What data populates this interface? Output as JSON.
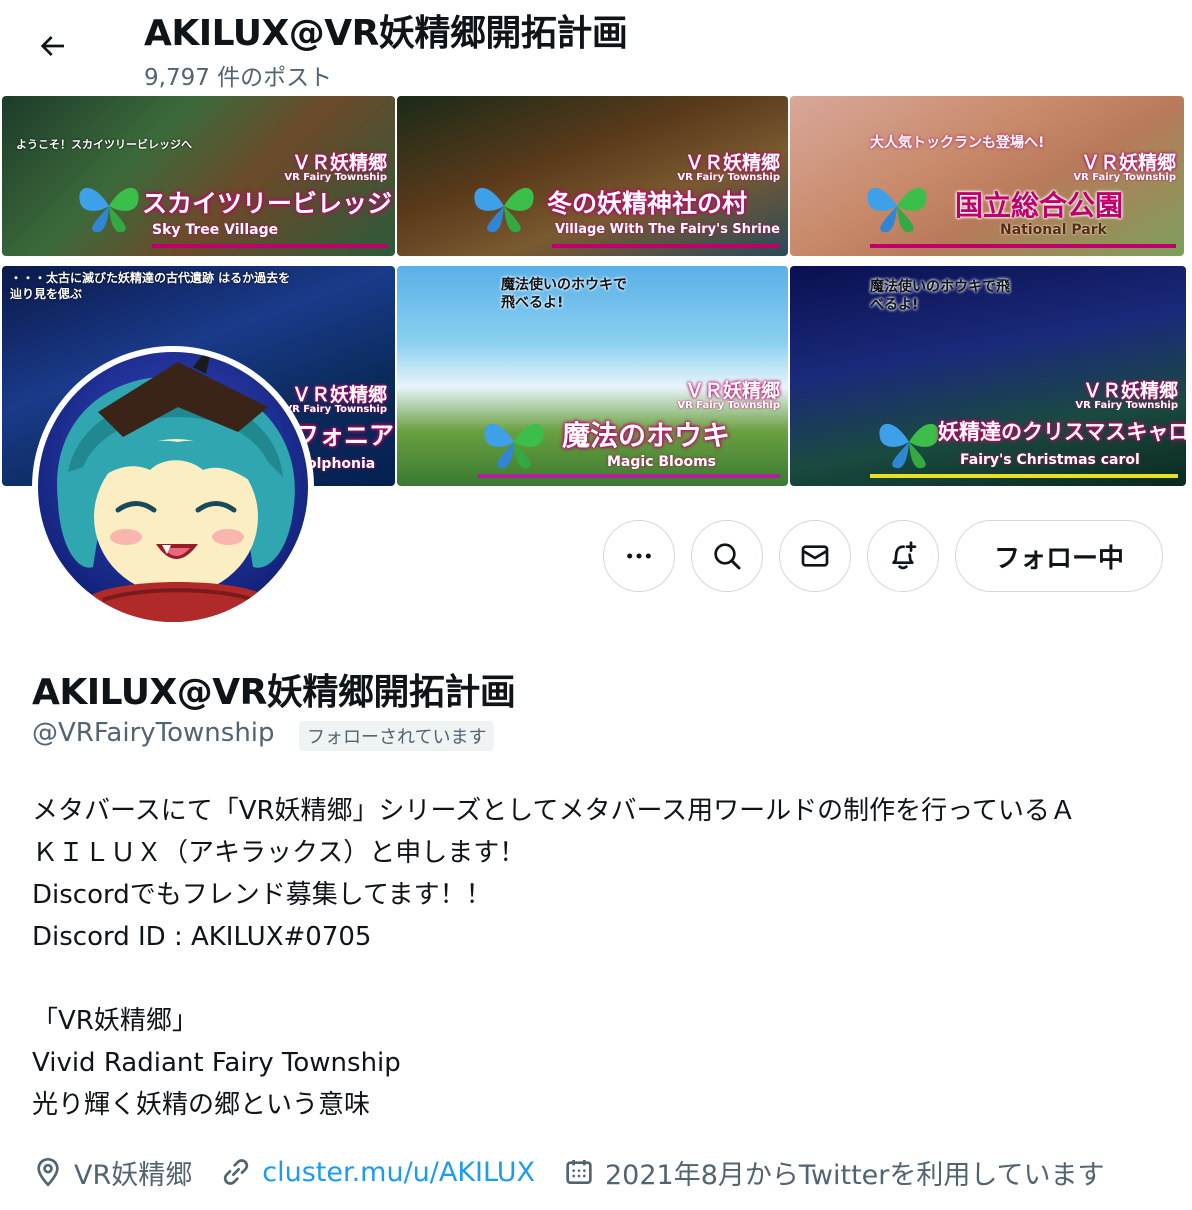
{
  "header": {
    "title": "AKILUX@VR妖精郷開拓計画",
    "post_count": "9,797 件のポスト"
  },
  "banner": {
    "tiles": [
      {
        "main": "スカイツリービレッジ",
        "en": "Sky Tree Village",
        "brand": "ＶＲ妖精郷",
        "sub": "VR Fairy Township",
        "note": "ようこそ！スカイツリービレッジへ"
      },
      {
        "main": "冬の妖精神社の村",
        "en": "Village With The Fairy's Shrine",
        "brand": "ＶＲ妖精郷",
        "sub": "VR Fairy Township",
        "note": ""
      },
      {
        "main": "国立総合公園",
        "en": "National Park",
        "brand": "ＶＲ妖精郷",
        "sub": "VR Fairy Township",
        "note": "大人気トックランも登場へ!"
      },
      {
        "main": "フォニア",
        "en": "olphonia",
        "brand": "ＶＲ妖精郷",
        "sub": "VR Fairy Township",
        "note": "・・・太古に滅びた妖精達の古代遺跡 はるか過去を辿り見を偲ぶ"
      },
      {
        "main": "魔法のホウキ",
        "en": "Magic Blooms",
        "brand": "ＶＲ妖精郷",
        "sub": "VR Fairy Township",
        "note": "魔法使いのホウキで飛べるよ!"
      },
      {
        "main": "妖精達のクリスマスキャロル",
        "en": "Fairy's Christmas carol",
        "brand": "ＶＲ妖精郷",
        "sub": "VR Fairy Township",
        "note": "魔法使いのホウキで飛べるよ!"
      }
    ]
  },
  "actions": {
    "follow_label": "フォロー中"
  },
  "profile": {
    "name": "AKILUX@VR妖精郷開拓計画",
    "handle": "@VRFairyTownship",
    "follows_you": "フォローされています",
    "bio_lines": [
      "メタバースにて「VR妖精郷」シリーズとしてメタバース用ワールドの制作を行っているＡ",
      "ＫＩＬＵＸ（アキラックス）と申します！",
      "Discordでもフレンド募集してます！！",
      "Discord ID : AKILUX#0705",
      "",
      "「VR妖精郷」",
      "Vivid Radiant Fairy Township",
      "光り輝く妖精の郷という意味"
    ],
    "location": "VR妖精郷",
    "website": "cluster.mu/u/AKILUX",
    "joined": "2021年8月からTwitterを利用しています"
  },
  "colors": {
    "accent": "#1d9bf0",
    "secondary_text": "#536471",
    "border": "#cfd9de",
    "banner_magenta": "#c0006a"
  }
}
